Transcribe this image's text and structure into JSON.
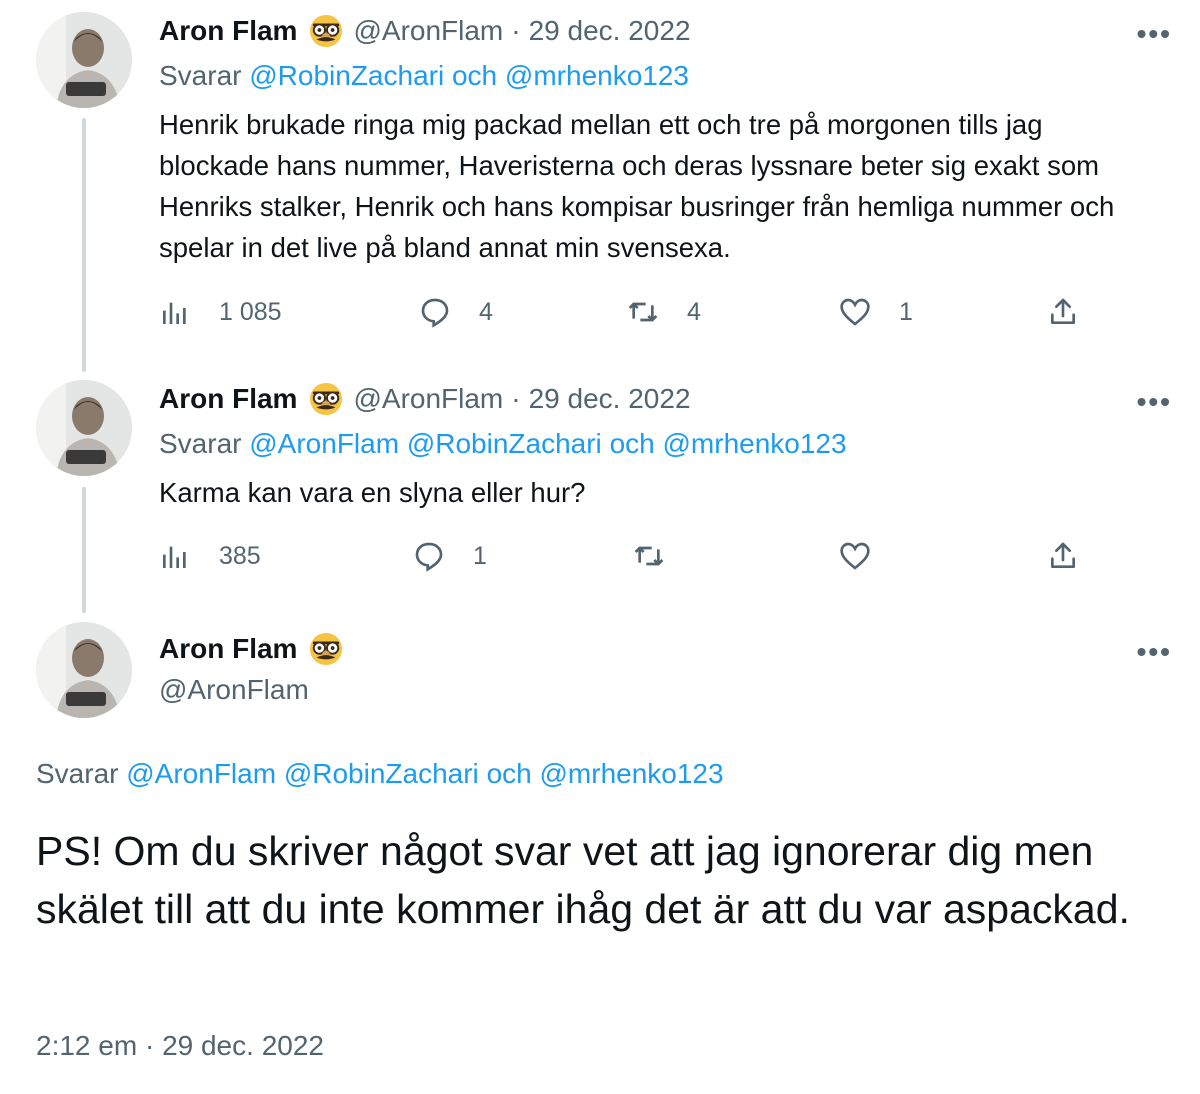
{
  "tweets": [
    {
      "name": "Aron Flam",
      "handle": "@AronFlam",
      "sep": "·",
      "date": "29 dec. 2022",
      "reply_prefix": "Svarar",
      "mention_1": "@RobinZachari",
      "and_word": "och",
      "mention_2": "@mrhenko123",
      "text": "Henrik brukade ringa mig packad mellan ett och tre på morgonen tills jag blockade hans nummer, Haveristerna och deras lyssnare beter sig exakt som Henriks stalker, Henrik och hans kompisar busringer från hemliga nummer och spelar in det live på bland annat min svensexa.",
      "views": "1 085",
      "replies": "4",
      "retweets": "4",
      "likes": "1"
    },
    {
      "name": "Aron Flam",
      "handle": "@AronFlam",
      "sep": "·",
      "date": "29 dec. 2022",
      "reply_prefix": "Svarar",
      "mention_0": "@AronFlam",
      "mention_1": "@RobinZachari",
      "and_word": "och",
      "mention_2": "@mrhenko123",
      "text": "Karma kan vara en slyna eller hur?",
      "views": "385",
      "replies": "1"
    }
  ],
  "main_tweet": {
    "name": "Aron Flam",
    "handle": "@AronFlam",
    "reply_prefix": "Svarar",
    "mention_0": "@AronFlam",
    "mention_1": "@RobinZachari",
    "and_word": "och",
    "mention_2": "@mrhenko123",
    "text": "PS! Om du skriver något svar vet att jag ignorerar dig men skälet till att du inte kommer ihåg det är att du var aspackad.",
    "time": "2:12 em",
    "sep": "·",
    "date": "29 dec. 2022"
  },
  "more_label": "•••",
  "icons": [
    "views-icon",
    "reply-icon",
    "retweet-icon",
    "like-icon",
    "share-icon",
    "disguise-emoji-icon",
    "more-icon"
  ],
  "colors": {
    "link": "#1d9bf0",
    "muted": "#536471",
    "text": "#0f1419",
    "thread": "#cfd9de"
  }
}
